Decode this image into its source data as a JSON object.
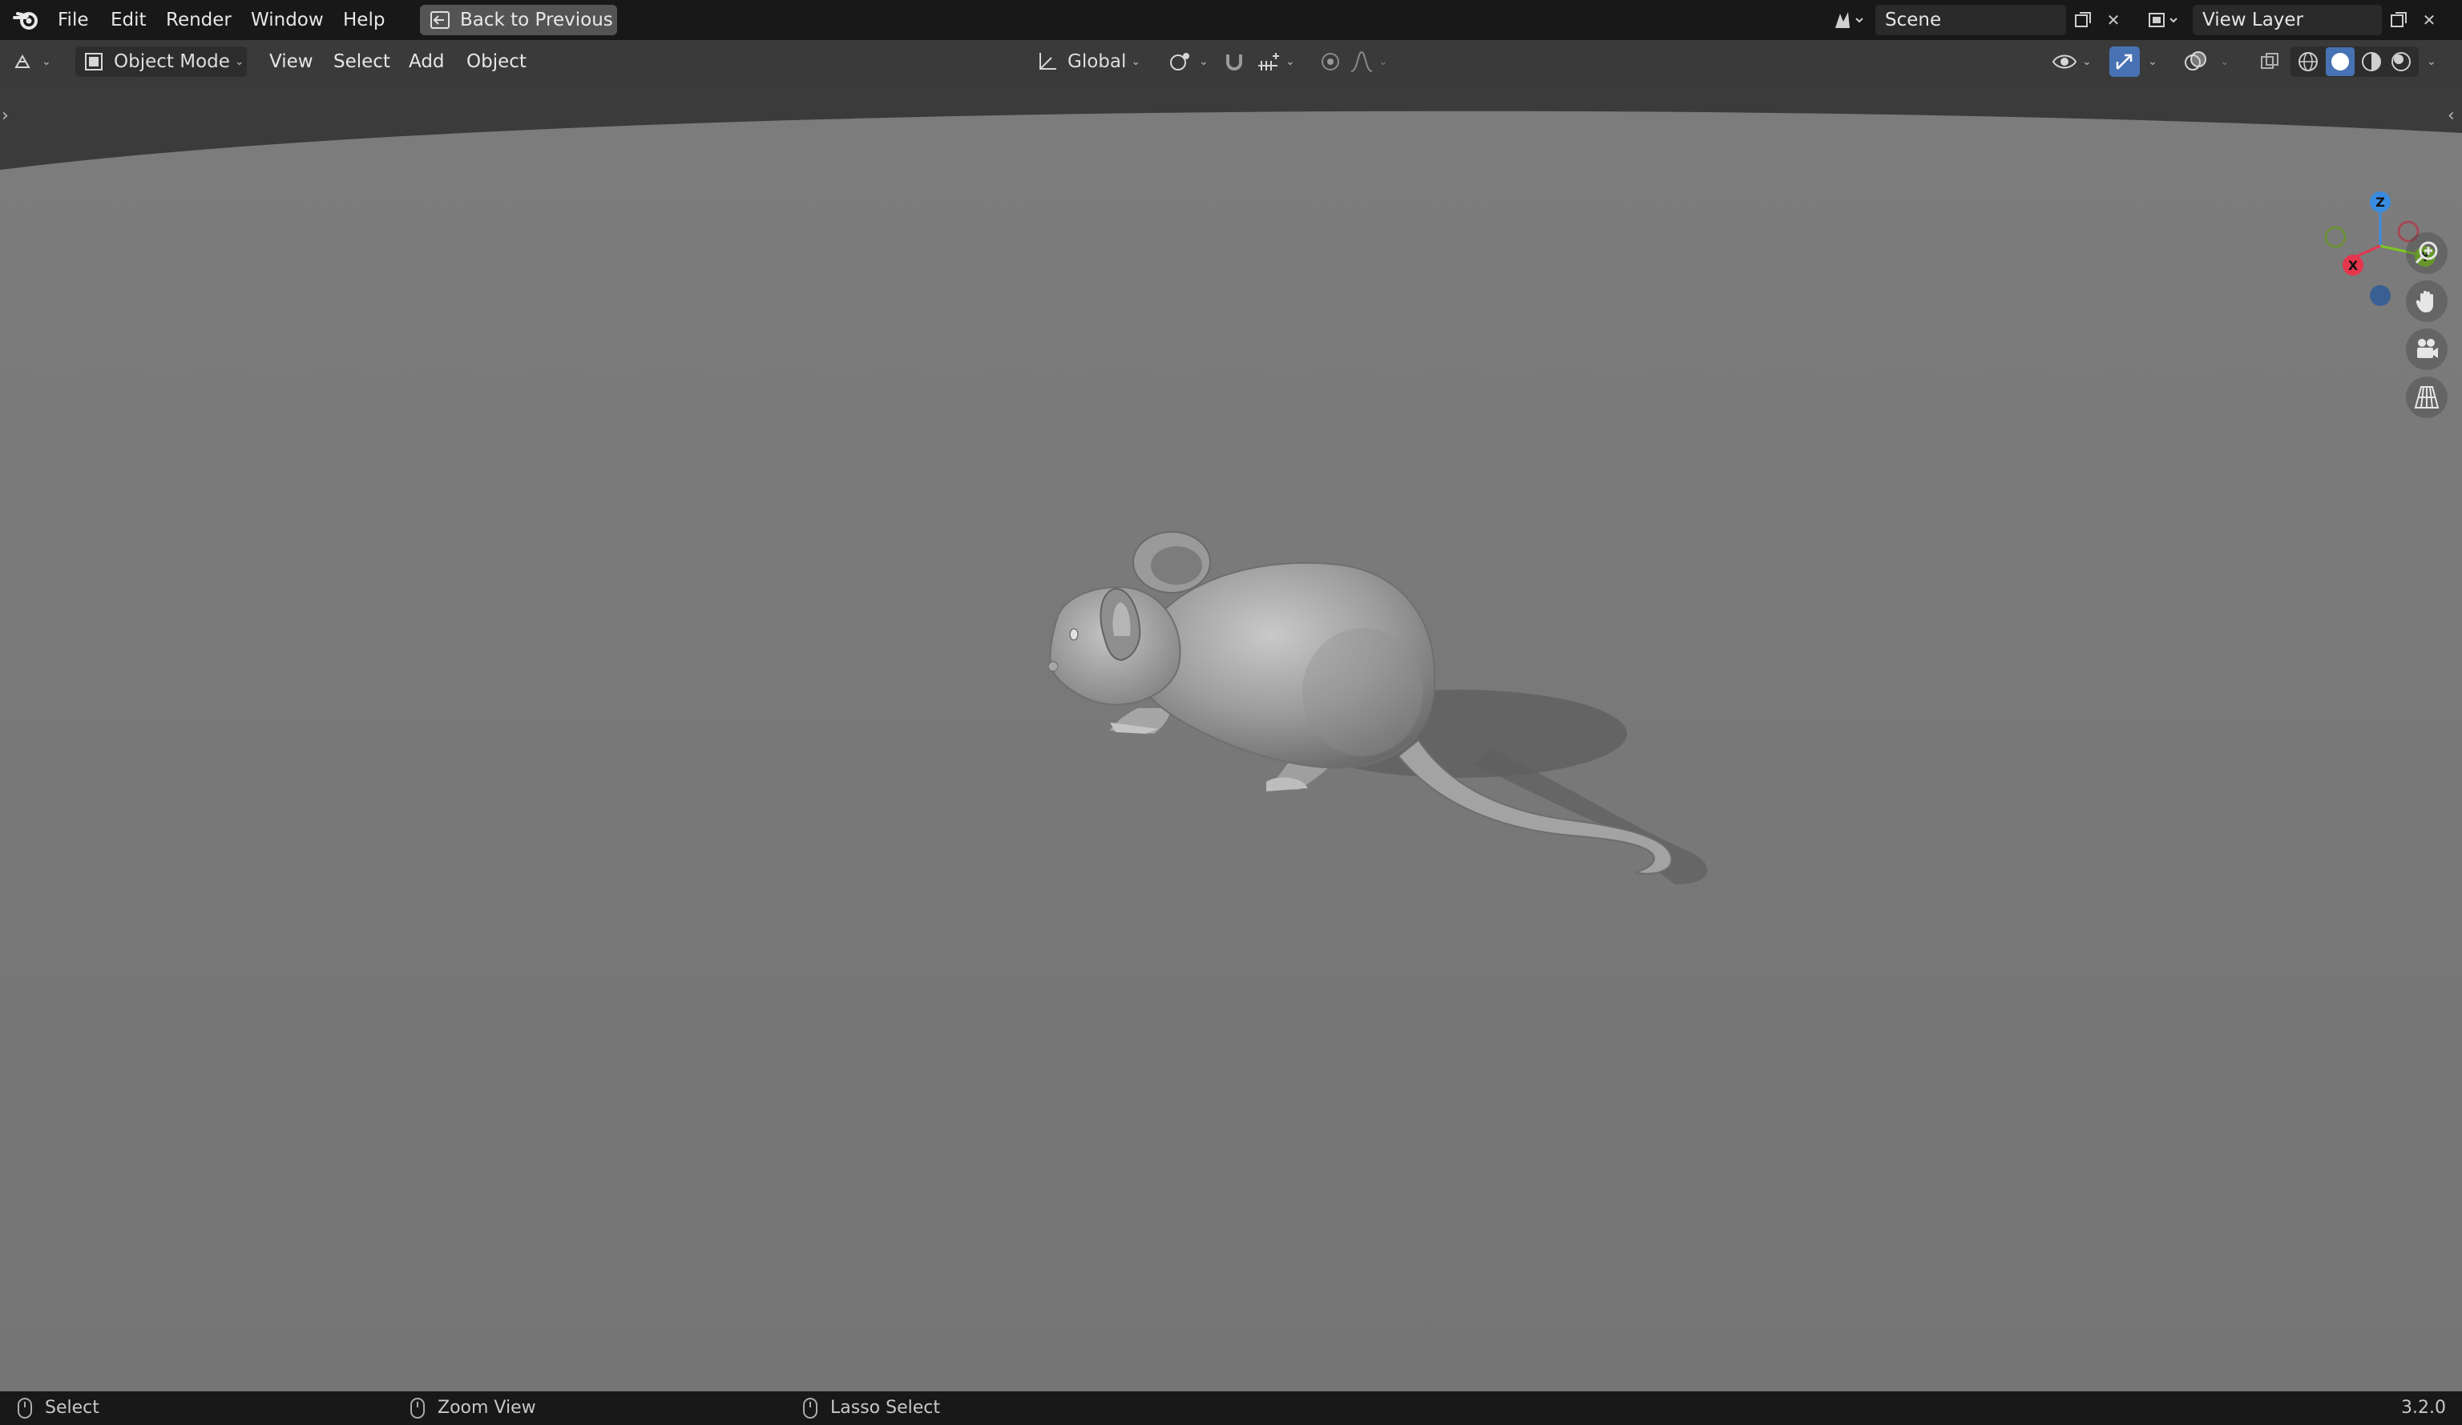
{
  "topbar": {
    "menus": [
      "File",
      "Edit",
      "Render",
      "Window",
      "Help"
    ],
    "back_button": "Back to Previous",
    "scene": "Scene",
    "view_layer": "View Layer"
  },
  "toolbar": {
    "mode": "Object Mode",
    "menus": [
      "View",
      "Select",
      "Add",
      "Object"
    ],
    "transform_orientation": "Global"
  },
  "gizmo": {
    "z_label": "Z",
    "y_label": "Y",
    "x_label": "X"
  },
  "statusbar": {
    "select": "Select",
    "zoom": "Zoom View",
    "lasso": "Lasso Select",
    "version": "3.2.0"
  },
  "colors": {
    "accent": "#4772b3",
    "axis_x": "#e6364d",
    "axis_y": "#7fc723",
    "axis_z": "#3a8ce0"
  }
}
